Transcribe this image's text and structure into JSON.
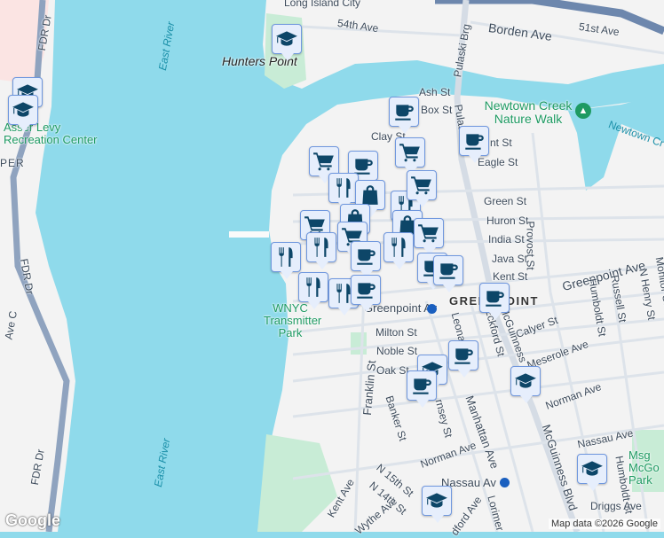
{
  "map": {
    "colors": {
      "water": "#8fdaeb",
      "land": "#f3f3f3",
      "park": "#c8ecd6",
      "marker_fill": "#e6eefc",
      "marker_border": "#6f97de",
      "icon": "#0d4668"
    },
    "labels": {
      "long_island_city": "Long Island City",
      "fdr_dr_1": "FDR Dr",
      "fdr_dr_2": "FDR Dr",
      "fdr_dr_3": "FDR Dr",
      "east_river_1": "East River",
      "east_river_2": "East River",
      "hunters_point": "Hunters Point",
      "asser_levy": "Asser Levy Recreation Center",
      "stuy": "PER",
      "ave_c": "Ave C",
      "ave_54": "54th Ave",
      "borden_ave": "Borden Ave",
      "ave_51": "51st Ave",
      "pulaski_brg_1": "Pulaski Brg",
      "pulaski_brg_2": "Pulaski",
      "ash_st": "Ash St",
      "box_st": "Box St",
      "clay_st": "Clay St",
      "dupont_st": "nt St",
      "eagle_st": "Eagle St",
      "newtown_creek_nature_walk": "Newtown Creek Nature Walk",
      "newtown_creek": "Newtown Cr",
      "green_st": "Green St",
      "huron_st": "Huron St",
      "india_st": "India St",
      "java_st": "Java St",
      "kent_st": "Kent St",
      "provost_st": "Provost St",
      "greenpoint_ave": "Greenpoint Ave",
      "russell_st": "Russell St",
      "n_henry_st": "N Henry St",
      "monitor_st": "Monitor St",
      "humboldt_st_1": "Humboldt St",
      "greenpoint": "GREENPOINT",
      "greenpoint_av_station": "Greenpoint Av",
      "wnyc": "WNYC Transmitter Park",
      "milton_st": "Milton St",
      "calyer_st": "Calyer St",
      "noble_st": "Noble St",
      "meserole_ave": "Meserole Ave",
      "oak_st": "Oak St",
      "eckford_st": "Eckford St",
      "leonard_st": "Leona",
      "mcguinness_1": "McGuinness",
      "mcguinness_blvd": "McGuinness Blvd",
      "franklin_st": "Franklin St",
      "banker_st": "Banker St",
      "guernsey_st": "rnsey St",
      "manhattan_ave": "Manhattan Ave",
      "norman_ave_1": "Norman Ave",
      "norman_ave_2": "Norman Ave",
      "nassau_ave": "Nassau Ave",
      "nassau_av_station": "Nassau Av",
      "humboldt_st_2": "Humboldt St",
      "driggs_ave": "Driggs Ave",
      "n_15th_st": "N 15th St",
      "n_14th_st": "N 14th St",
      "kent_ave": "Kent Ave",
      "wythe_ave": "Wythe Ave",
      "bedford_ave": "dford Ave",
      "lorimer": "Lorimer",
      "mccarren_park": "Msg McGo Park"
    },
    "markers": [
      {
        "type": "school",
        "icon": "graduation-cap-icon"
      },
      {
        "type": "school",
        "icon": "graduation-cap-icon"
      },
      {
        "type": "school",
        "icon": "graduation-cap-icon"
      },
      {
        "type": "cafe",
        "icon": "coffee-cup-icon"
      },
      {
        "type": "cafe",
        "icon": "coffee-cup-icon"
      },
      {
        "type": "grocery",
        "icon": "shopping-cart-icon"
      },
      {
        "type": "grocery",
        "icon": "shopping-cart-icon"
      },
      {
        "type": "cafe",
        "icon": "coffee-cup-icon"
      },
      {
        "type": "restaurant",
        "icon": "cutlery-icon"
      },
      {
        "type": "shopping",
        "icon": "shopping-bag-icon"
      },
      {
        "type": "restaurant",
        "icon": "cutlery-icon"
      },
      {
        "type": "grocery",
        "icon": "shopping-cart-icon"
      },
      {
        "type": "shopping",
        "icon": "shopping-bag-icon"
      },
      {
        "type": "shopping",
        "icon": "shopping-bag-icon"
      },
      {
        "type": "grocery",
        "icon": "shopping-cart-icon"
      },
      {
        "type": "grocery",
        "icon": "shopping-cart-icon"
      },
      {
        "type": "restaurant",
        "icon": "cutlery-icon"
      },
      {
        "type": "restaurant",
        "icon": "cutlery-icon"
      },
      {
        "type": "restaurant",
        "icon": "cutlery-icon"
      },
      {
        "type": "grocery",
        "icon": "shopping-cart-icon"
      },
      {
        "type": "cafe",
        "icon": "coffee-cup-icon"
      },
      {
        "type": "cafe",
        "icon": "coffee-cup-icon"
      },
      {
        "type": "restaurant",
        "icon": "cutlery-icon"
      },
      {
        "type": "restaurant",
        "icon": "cutlery-icon"
      },
      {
        "type": "cafe",
        "icon": "coffee-cup-icon"
      },
      {
        "type": "cafe",
        "icon": "coffee-cup-icon"
      },
      {
        "type": "cafe",
        "icon": "coffee-cup-icon"
      },
      {
        "type": "school",
        "icon": "graduation-cap-icon"
      },
      {
        "type": "cafe",
        "icon": "coffee-cup-icon"
      },
      {
        "type": "cafe",
        "icon": "coffee-cup-icon"
      },
      {
        "type": "school",
        "icon": "graduation-cap-icon"
      },
      {
        "type": "school",
        "icon": "graduation-cap-icon"
      },
      {
        "type": "school",
        "icon": "graduation-cap-icon"
      }
    ],
    "attribution": "Map data ©2026 Google",
    "logo": "Google"
  }
}
